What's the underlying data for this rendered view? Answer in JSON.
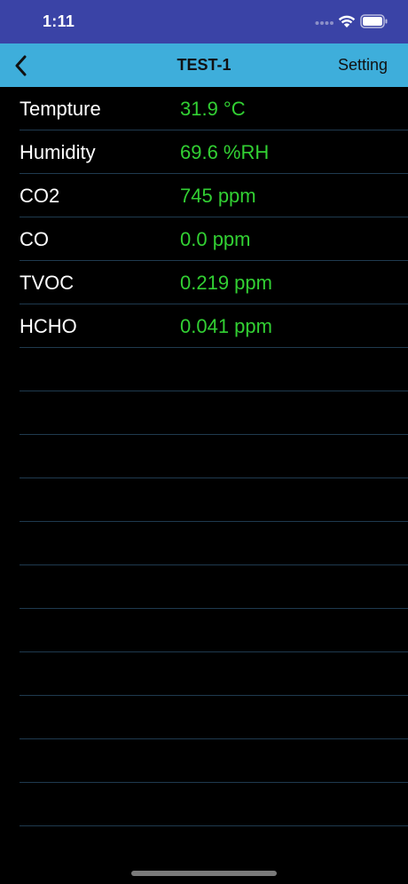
{
  "status_bar": {
    "time": "1:11"
  },
  "nav": {
    "back_icon": "chevron-left-icon",
    "title": "TEST-1",
    "setting_label": "Setting"
  },
  "readings": [
    {
      "label": "Tempture",
      "value": "31.9 °C"
    },
    {
      "label": "Humidity",
      "value": "69.6 %RH"
    },
    {
      "label": "CO2",
      "value": "745 ppm"
    },
    {
      "label": "CO",
      "value": "0.0 ppm"
    },
    {
      "label": "TVOC",
      "value": "0.219 ppm"
    },
    {
      "label": "HCHO",
      "value": "0.041 ppm"
    }
  ],
  "empty_rows": 11,
  "colors": {
    "status_bar_bg": "#3a43a6",
    "nav_bar_bg": "#3eaedb",
    "background": "#000000",
    "value_text": "#32d033",
    "label_text": "#ffffff",
    "separator": "#1f3a4f"
  }
}
